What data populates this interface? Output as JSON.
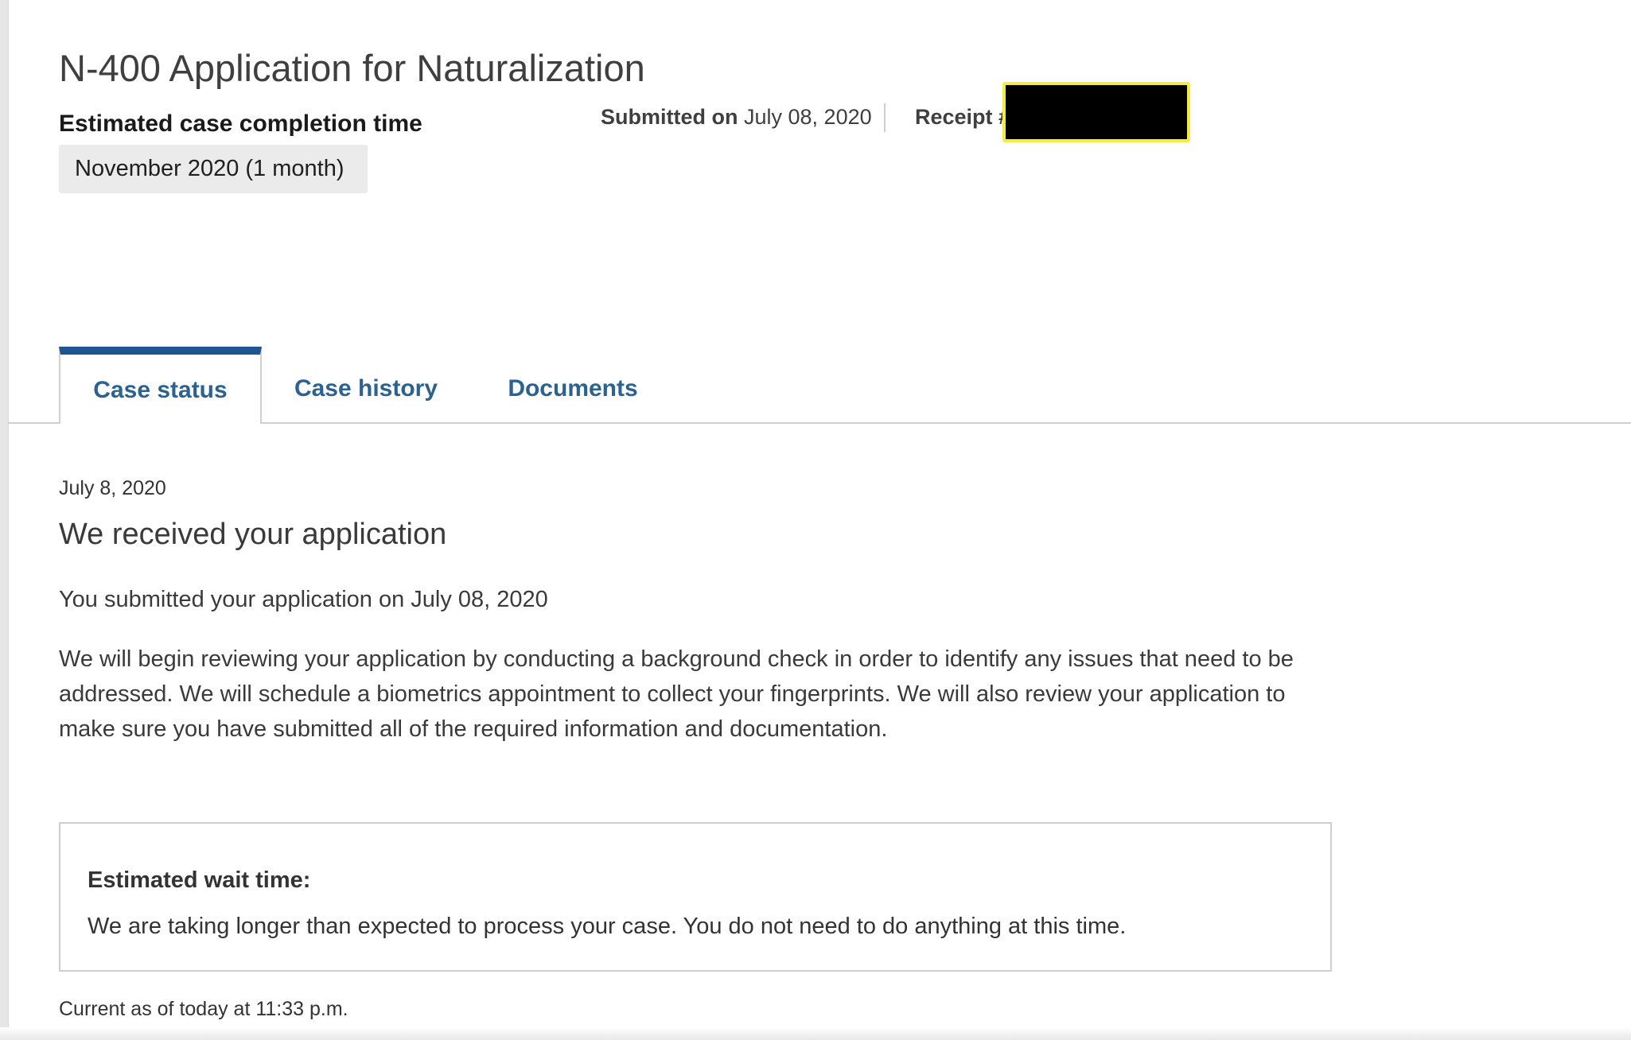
{
  "header": {
    "title": "N-400 Application for Naturalization",
    "completion_label": "Estimated case completion time",
    "completion_value": "November 2020 (1 month)",
    "submitted_label": "Submitted on",
    "submitted_date": "July 08, 2020",
    "receipt_label": "Receipt #"
  },
  "tabs": [
    {
      "label": "Case status",
      "active": true
    },
    {
      "label": "Case history",
      "active": false
    },
    {
      "label": "Documents",
      "active": false
    }
  ],
  "case_status": {
    "date": "July 8, 2020",
    "title": "We received your application",
    "submitted_text": "You submitted your application on July 08, 2020",
    "body": "We will begin reviewing your application by conducting a background check in order to identify any issues that need to be addressed. We will schedule a biometrics appointment to collect your fingerprints. We will also review your application to make sure you have submitted all of the required information and documentation.",
    "wait_title": "Estimated wait time:",
    "wait_text": "We are taking longer than expected to process your case. You do not need to do anything at this time.",
    "current_as_of": "Current as of today at 11:33 p.m."
  },
  "colors": {
    "tab_text": "#2c6290",
    "tab_active_bar": "#1f5590",
    "redaction_outline": "#f5ec41"
  }
}
